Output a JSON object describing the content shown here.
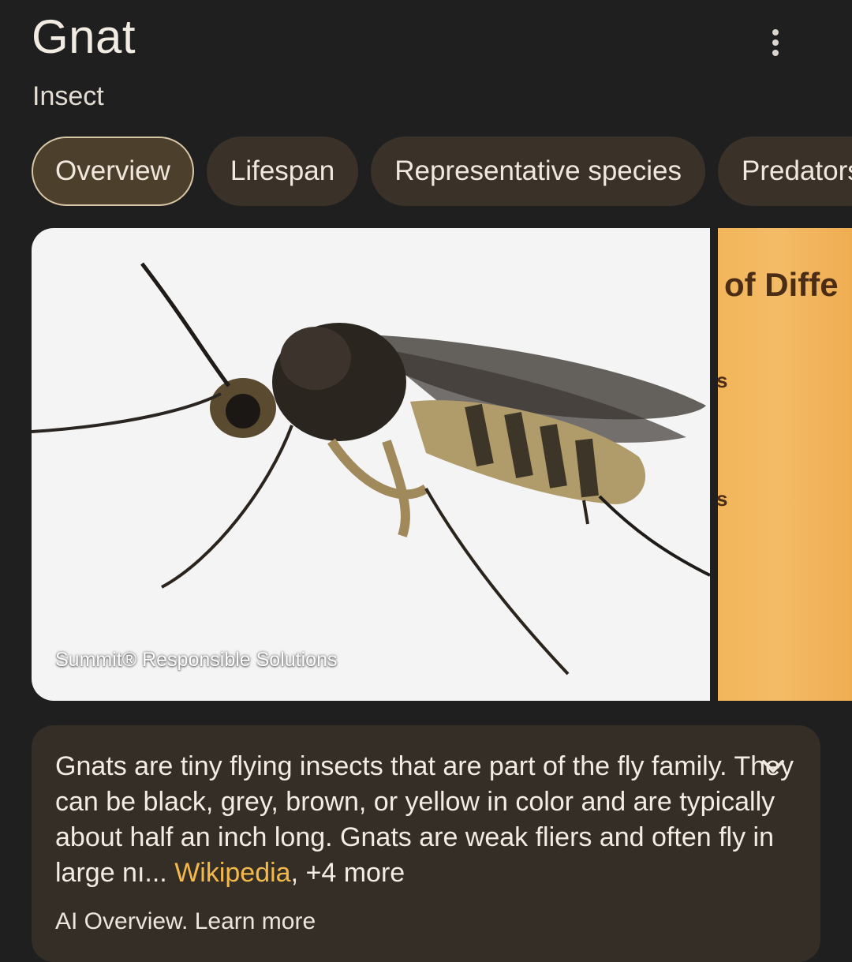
{
  "header": {
    "title": "Gnat",
    "subtitle": "Insect"
  },
  "tabs": [
    {
      "label": "Overview",
      "active": true
    },
    {
      "label": "Lifespan",
      "active": false
    },
    {
      "label": "Representative species",
      "active": false
    },
    {
      "label": "Predators",
      "active": false
    }
  ],
  "images": {
    "main_credit": "Summit® Responsible Solutions",
    "second_text_1": "of Diffe",
    "second_text_2": "s",
    "second_text_3": "s"
  },
  "summary": {
    "text": "Gnats are tiny flying insects that are part of the fly family. They can be black, grey, brown, or yellow in color and are typically about half an inch long. Gnats are weak fliers and often fly in large nı...",
    "source": "Wikipedia",
    "more": "+4 more",
    "ai_label": "AI Overview.",
    "learn_more": "Learn more"
  },
  "colors": {
    "background": "#1f1f1f",
    "chip": "#3a3129",
    "chip_active": "#4c3f2c",
    "source_link": "#f3b94a",
    "card": "#352e27"
  }
}
